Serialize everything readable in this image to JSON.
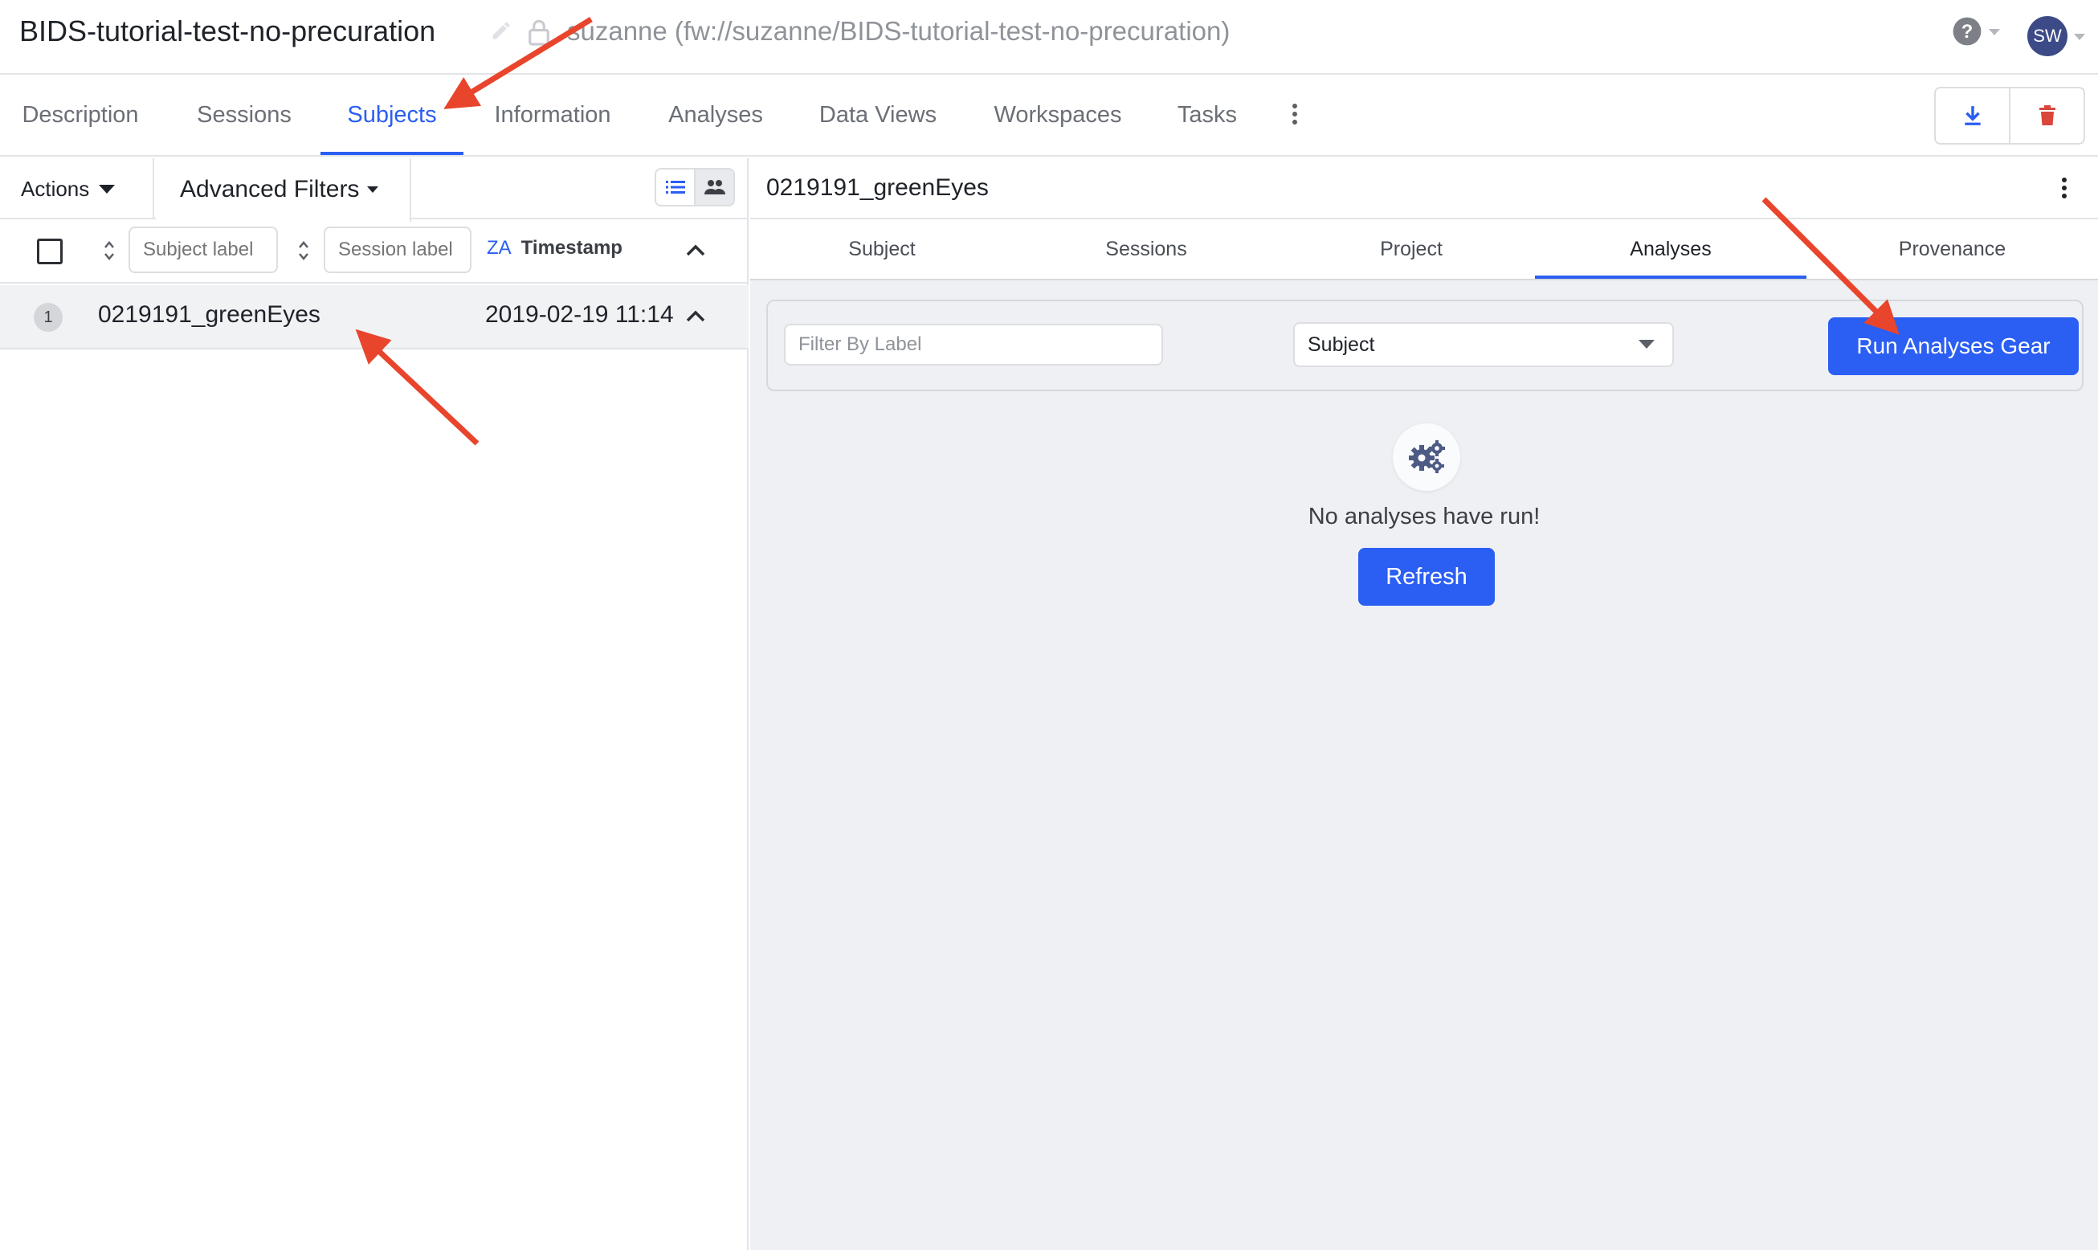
{
  "header": {
    "project_title": "BIDS-tutorial-test-no-precuration",
    "project_path": "suzanne (fw://suzanne/BIDS-tutorial-test-no-precuration)",
    "avatar_initials": "SW"
  },
  "main_tabs": [
    {
      "label": "Description"
    },
    {
      "label": "Sessions"
    },
    {
      "label": "Subjects",
      "active": true
    },
    {
      "label": "Information"
    },
    {
      "label": "Analyses"
    },
    {
      "label": "Data Views"
    },
    {
      "label": "Workspaces"
    },
    {
      "label": "Tasks"
    }
  ],
  "left_panel": {
    "actions_label": "Actions",
    "advanced_filters_label": "Advanced Filters",
    "subject_label_placeholder": "Subject label",
    "session_label_placeholder": "Session label",
    "sort_icon_text": "ZA",
    "timestamp_header": "Timestamp",
    "rows": [
      {
        "index": "1",
        "label": "0219191_greenEyes",
        "timestamp": "2019-02-19 11:14"
      }
    ]
  },
  "right_panel": {
    "title": "0219191_greenEyes",
    "tabs": [
      {
        "label": "Subject"
      },
      {
        "label": "Sessions"
      },
      {
        "label": "Project"
      },
      {
        "label": "Analyses",
        "active": true
      },
      {
        "label": "Provenance"
      }
    ],
    "filter_placeholder": "Filter By Label",
    "select_value": "Subject",
    "run_button_label": "Run Analyses Gear",
    "empty_message": "No analyses have run!",
    "refresh_label": "Refresh"
  },
  "colors": {
    "accent": "#2b5ef2",
    "annotation_arrow": "#e8452c",
    "delete_icon": "#d9473b",
    "panel_bg": "#eef0f4"
  }
}
